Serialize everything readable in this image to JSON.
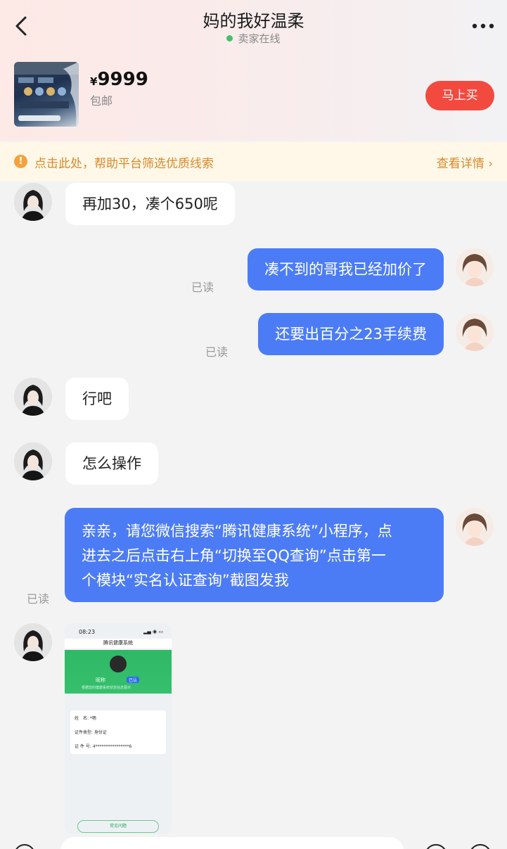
{
  "header": {
    "title": "妈的我好温柔",
    "status": "卖家在线",
    "status_color": "#3fc26b"
  },
  "product": {
    "currency": "¥",
    "price": "9999",
    "shipping": "包邮",
    "buy_label": "马上买",
    "buy_color": "#f24a3f"
  },
  "notice": {
    "icon": "!",
    "text": "点击此处，帮助平台筛选优质线索",
    "link": "查看详情 ›"
  },
  "messages": {
    "m1": "再加30，凑个650呢",
    "m2": "凑不到的哥我已经加价了",
    "m3": "还要出百分之23手续费",
    "m4": "行吧",
    "m5": "怎么操作",
    "m6_lines": [
      "亲亲，请您微信搜索“腾讯健康系统”小程序，点",
      "进去之后点击右上角“切换至QQ查询”点击第一",
      "个模块“实名认证查询”截图发我"
    ],
    "read_label": "已读"
  },
  "screenshot": {
    "time": "08:23",
    "nav_title": "腾讯健康系统",
    "name": "昵称",
    "tag": "已认",
    "desc": "根据您的健康系统状态信息展示",
    "rows": [
      "姓　名: *畅",
      "证件类型: 身份证",
      "证 件 号: 4****************6"
    ],
    "bottom_btn": "常见问题"
  },
  "colors": {
    "accent_blue": "#4c7cf5",
    "notice_text": "#d8892b"
  }
}
